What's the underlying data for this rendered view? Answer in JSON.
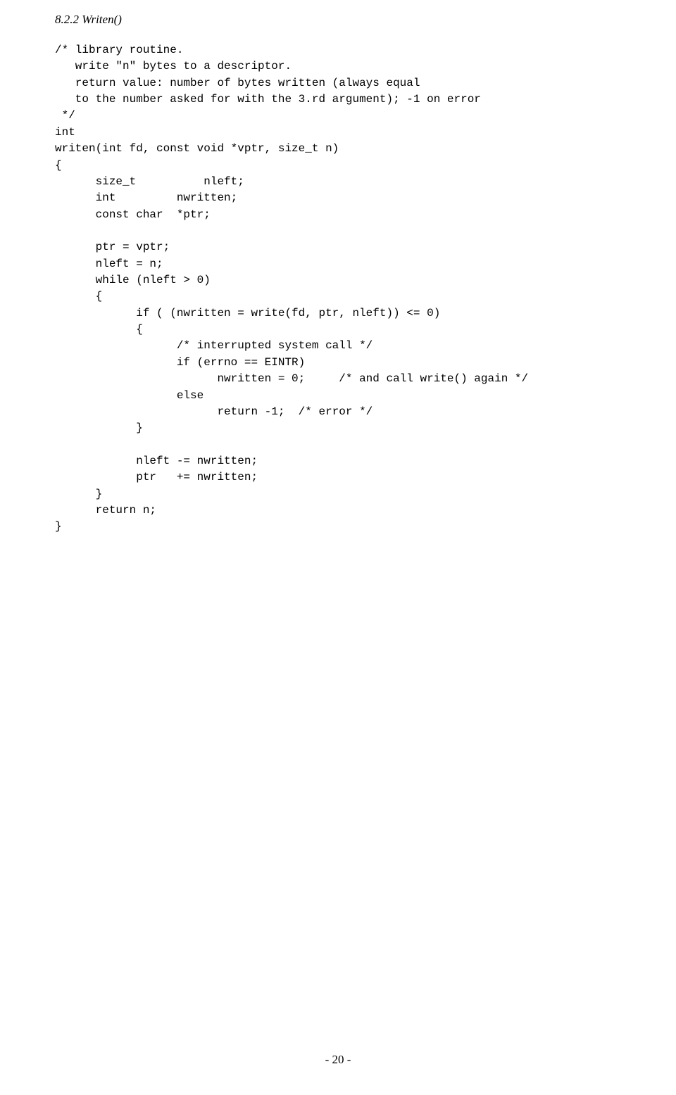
{
  "heading": "8.2.2 Writen()",
  "code": "/* library routine.\n   write \"n\" bytes to a descriptor.\n   return value: number of bytes written (always equal\n   to the number asked for with the 3.rd argument); -1 on error\n */\nint\nwriten(int fd, const void *vptr, size_t n)\n{\n      size_t          nleft;\n      int         nwritten;\n      const char  *ptr;\n\n      ptr = vptr;\n      nleft = n;\n      while (nleft > 0)\n      {\n            if ( (nwritten = write(fd, ptr, nleft)) <= 0)\n            {\n                  /* interrupted system call */\n                  if (errno == EINTR)\n                        nwritten = 0;     /* and call write() again */\n                  else\n                        return -1;  /* error */\n            }\n\n            nleft -= nwritten;\n            ptr   += nwritten;\n      }\n      return n;\n}",
  "pageNumber": "- 20 -"
}
